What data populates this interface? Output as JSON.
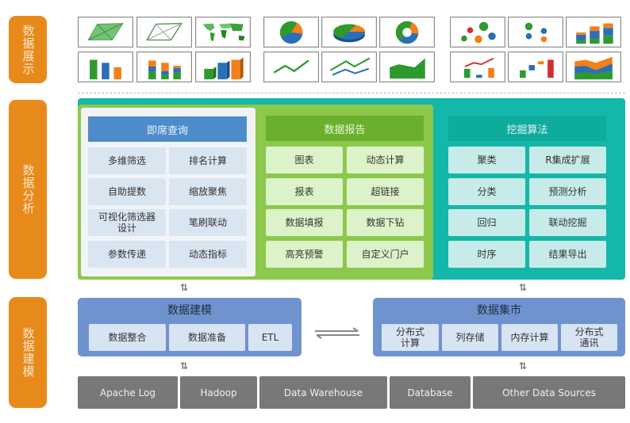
{
  "layers": {
    "display": "数据展示",
    "analysis": "数据分析",
    "modeling": "数据建模"
  },
  "thumbnails": [
    {
      "name": "radar-filled-chart-icon"
    },
    {
      "name": "radar-line-chart-icon"
    },
    {
      "name": "world-map-chart-icon"
    },
    {
      "name": "pie-chart-icon"
    },
    {
      "name": "pie-3d-chart-icon"
    },
    {
      "name": "donut-chart-icon"
    },
    {
      "name": "bubble-chart-icon"
    },
    {
      "name": "scatter-chart-icon"
    },
    {
      "name": "stacked-bar-3d-chart-icon"
    },
    {
      "name": "bar-chart-icon"
    },
    {
      "name": "stacked-bar-chart-icon"
    },
    {
      "name": "bar-3d-chart-icon"
    },
    {
      "name": "line-chart-icon"
    },
    {
      "name": "multi-line-chart-icon"
    },
    {
      "name": "area-chart-icon"
    },
    {
      "name": "combo-bar-line-chart-icon"
    },
    {
      "name": "waterfall-chart-icon"
    },
    {
      "name": "stacked-area-chart-icon"
    }
  ],
  "colors": {
    "layer_label": "#e88a1a",
    "query": "#4d8ccb",
    "report": "#8cc84b",
    "mining": "#14b7a9",
    "model": "#6f93ce",
    "source": "#787878"
  },
  "analysis": {
    "query": {
      "title": "即席查询",
      "items": [
        "多维筛选",
        "排名计算",
        "自助提数",
        "缩放聚焦",
        "可视化筛选器\n设计",
        "笔刷联动",
        "参数传递",
        "动态指标"
      ]
    },
    "report": {
      "title": "数据报告",
      "items": [
        "图表",
        "动态计算",
        "报表",
        "超链接",
        "数据填报",
        "数据下钻",
        "高亮预警",
        "自定义门户"
      ]
    },
    "mining": {
      "title": "挖掘算法",
      "items": [
        "聚类",
        "R集成扩展",
        "分类",
        "预测分析",
        "回归",
        "联动挖掘",
        "时序",
        "结果导出"
      ]
    }
  },
  "modeling": {
    "title": "数据建模",
    "items": [
      "数据整合",
      "数据准备",
      "ETL"
    ]
  },
  "mart": {
    "title": "数据集市",
    "items": [
      "分布式\n计算",
      "列存储",
      "内存计算",
      "分布式\n通讯"
    ]
  },
  "arrows": {
    "vertical": "⇅"
  },
  "sources": [
    "Apache Log",
    "Hadoop",
    "Data Warehouse",
    "Database",
    "Other Data Sources"
  ]
}
